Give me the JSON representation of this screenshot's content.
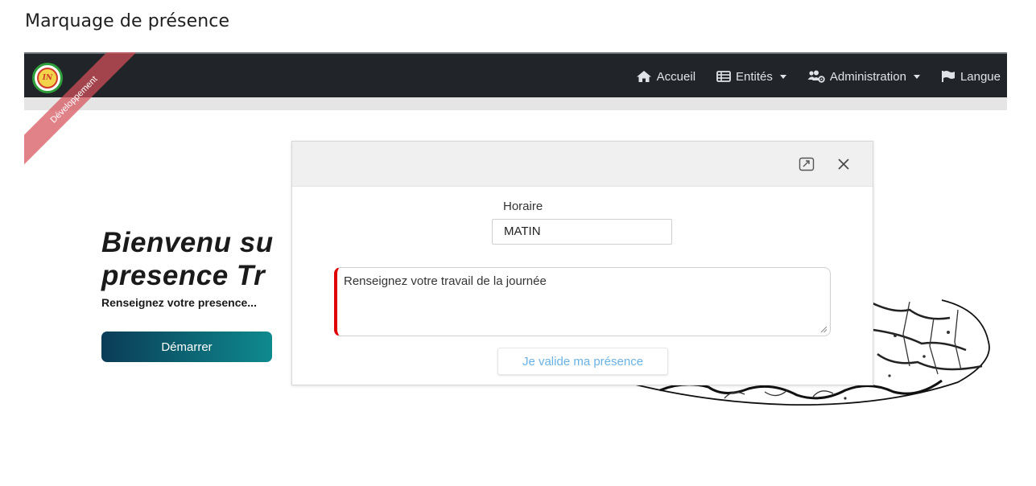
{
  "page": {
    "heading": "Marquage de présence"
  },
  "navbar": {
    "ribbon_text": "Développement",
    "logo_text": "IN",
    "items": [
      {
        "label": "Accueil",
        "icon": "home-icon",
        "dropdown": false
      },
      {
        "label": "Entités",
        "icon": "table-icon",
        "dropdown": true
      },
      {
        "label": "Administration",
        "icon": "users-cog-icon",
        "dropdown": true
      },
      {
        "label": "Langue",
        "icon": "flag-icon",
        "dropdown": false
      }
    ]
  },
  "hero": {
    "title_line1": "Bienvenu su",
    "title_line2": "presence Tr",
    "subtitle": "Renseignez votre presence...",
    "start_button": "Démarrer"
  },
  "modal": {
    "horaire_label": "Horaire",
    "horaire_value": "MATIN",
    "work_placeholder": "Renseignez votre travail de la journée",
    "submit_label": "Je valide ma présence",
    "header_icons": [
      "maximize-icon",
      "close-icon"
    ]
  },
  "colors": {
    "navbar_bg": "#212529",
    "ribbon": "#d6505a",
    "start_gradient_from": "#0b3c57",
    "start_gradient_to": "#0e8a8e",
    "textarea_accent": "#e00000",
    "submit_text": "#6ab3e8"
  }
}
